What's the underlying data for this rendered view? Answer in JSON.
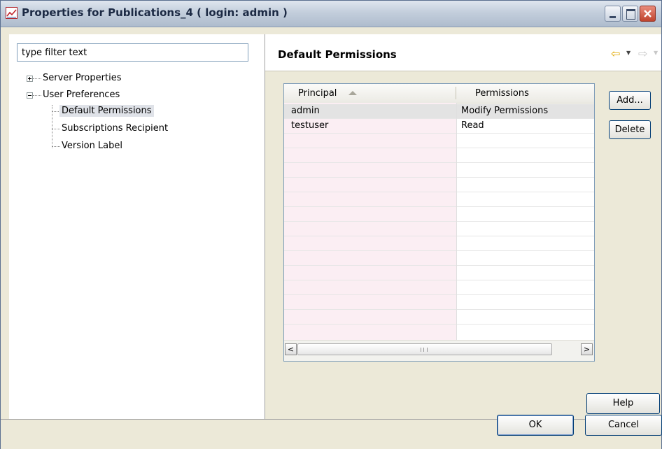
{
  "window": {
    "title": "Properties for Publications_4 ( login: admin )"
  },
  "filter": {
    "placeholder": "type filter text",
    "value": "type filter text"
  },
  "tree": {
    "items": [
      {
        "label": "Server Properties",
        "expanded": false,
        "level": 0
      },
      {
        "label": "User Preferences",
        "expanded": true,
        "level": 0
      },
      {
        "label": "Default Permissions",
        "level": 1,
        "selected": true
      },
      {
        "label": "Subscriptions Recipient",
        "level": 1
      },
      {
        "label": "Version Label",
        "level": 1
      }
    ]
  },
  "page": {
    "title": "Default Permissions"
  },
  "table": {
    "columns": [
      "Principal",
      "Permissions"
    ],
    "sort_column": "Principal",
    "sort_direction": "ascending",
    "rows": [
      {
        "principal": "admin",
        "permissions": "Modify Permissions"
      },
      {
        "principal": "testuser",
        "permissions": "Read"
      }
    ]
  },
  "buttons": {
    "add": "Add...",
    "delete": "Delete",
    "help": "Help",
    "ok": "OK",
    "cancel": "Cancel"
  },
  "icons": {
    "back": "back-arrow-icon",
    "forward": "forward-arrow-icon"
  },
  "colors": {
    "principal_column_bg": "#fbeef3",
    "selected_row_bg": "#e3e3e3",
    "back_arrow": "#e0a800"
  }
}
